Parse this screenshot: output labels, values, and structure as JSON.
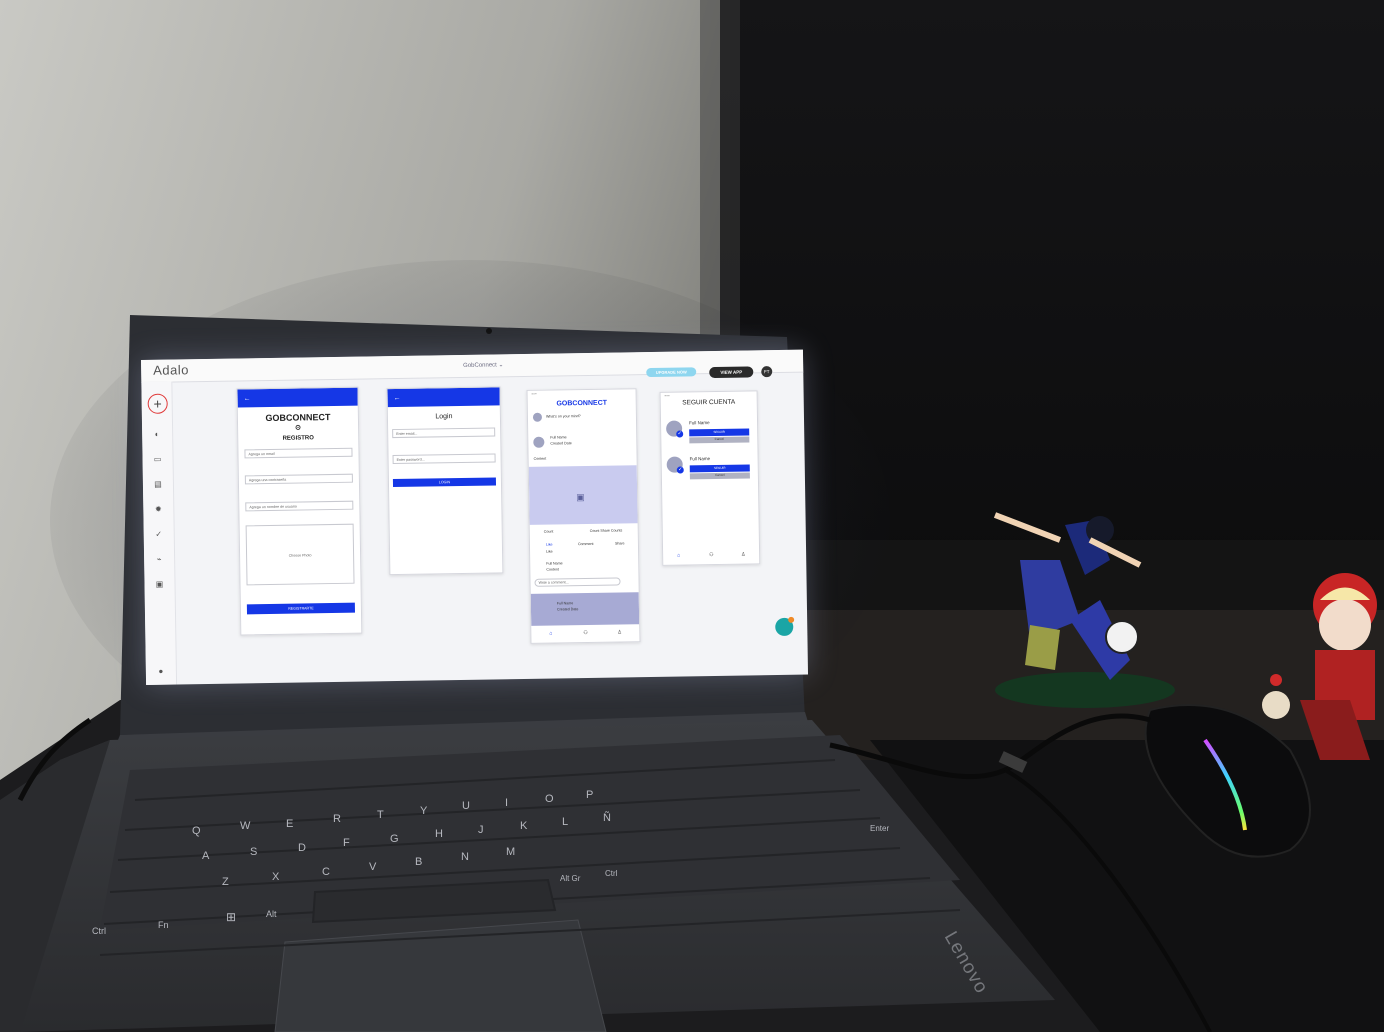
{
  "app": {
    "logo": "Adalo",
    "project": "GobConnect ⌄",
    "upgrade": "UPGRADE NOW",
    "view_app": "VIEW APP",
    "user_initials": "FT"
  },
  "screen_registro": {
    "app_name": "GOBCONNECT",
    "title": "REGISTRO",
    "email_placeholder": "Agrega un email",
    "password_placeholder": "Agrega una contraseña",
    "username_placeholder": "Agrega un nombre de usuario",
    "photo_label": "Choose Photo",
    "submit": "REGISTRARTE"
  },
  "screen_login": {
    "title": "Login",
    "email_placeholder": "Enter email...",
    "password_placeholder": "Enter password...",
    "submit": "LOGIN"
  },
  "screen_feed": {
    "app_name": "GOBCONNECT",
    "prompt": "What's on your mind?",
    "full_name": "Full Name",
    "created_date": "Created Date",
    "content": "Content",
    "count": "Count",
    "count_share": "Count Share Counts",
    "like": "Like",
    "comment": "Comment",
    "share": "Share",
    "comment_name": "Full Name",
    "comment_content": "Content",
    "write_comment": "Write a comment...",
    "footer_name": "Full Name",
    "footer_date": "Created Date"
  },
  "screen_seguir": {
    "title": "SEGUIR CUENTA",
    "users": [
      {
        "name": "Full Name",
        "follow": "SEGUIR",
        "cancel": "Cancel"
      },
      {
        "name": "Full Name",
        "follow": "SEGUIR",
        "cancel": "Cancel"
      }
    ]
  },
  "keyboard": {
    "row_top": [
      "Q",
      "W",
      "E",
      "R",
      "T",
      "Y",
      "U",
      "I",
      "O",
      "P"
    ],
    "row_mid": [
      "A",
      "S",
      "D",
      "F",
      "G",
      "H",
      "J",
      "K",
      "L",
      "Ñ"
    ],
    "row_low": [
      "Z",
      "X",
      "C",
      "V",
      "B",
      "N",
      "M"
    ],
    "mods": {
      "ctrl": "Ctrl",
      "fn": "Fn",
      "alt": "Alt",
      "altgr": "Alt Gr",
      "ctrl_r": "Ctrl",
      "enter": "Enter"
    }
  },
  "brand": "Lenovo",
  "colors": {
    "adalo_blue": "#1537e6",
    "upgrade": "#8ed6ef",
    "mouse_rgb": "#39d8c8"
  }
}
